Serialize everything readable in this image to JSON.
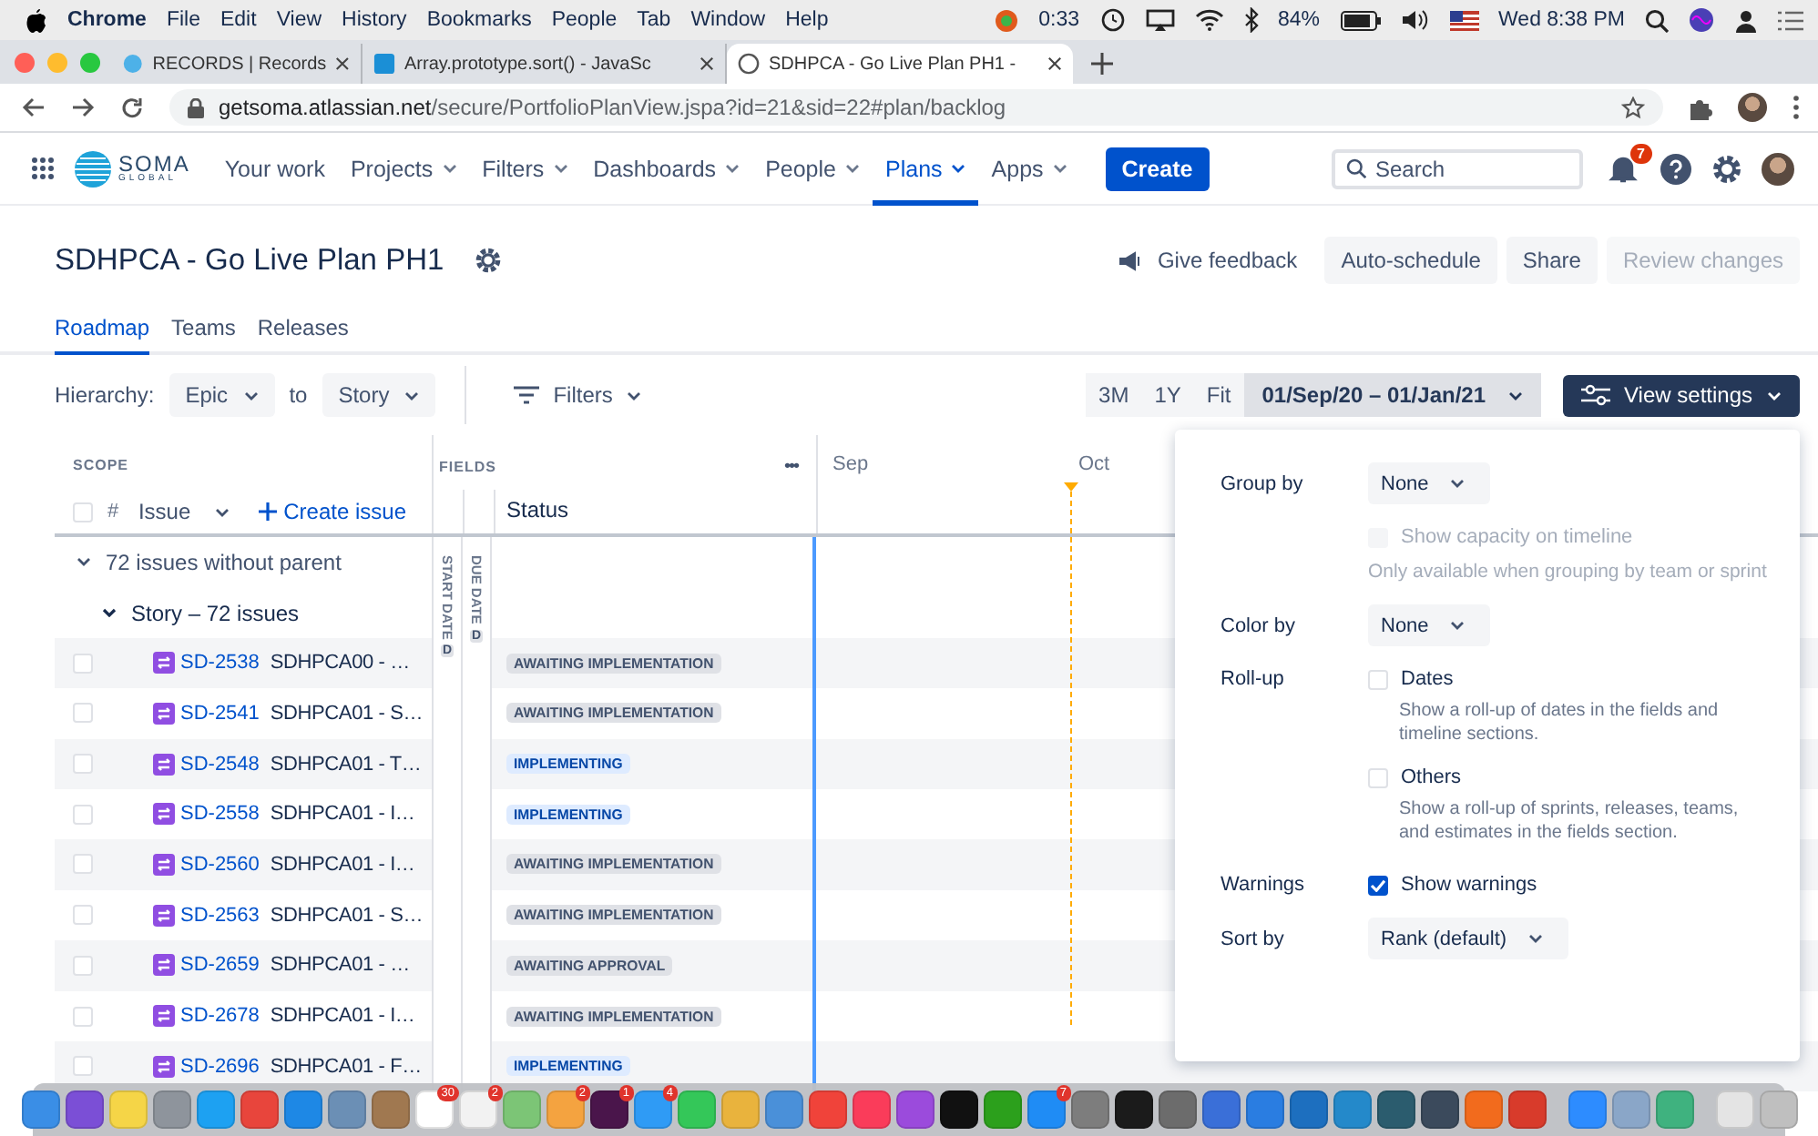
{
  "menubar": {
    "app": "Chrome",
    "menus": [
      "File",
      "Edit",
      "View",
      "History",
      "Bookmarks",
      "People",
      "Tab",
      "Window",
      "Help"
    ],
    "timer": "0:33",
    "battery": "84%",
    "clock": "Wed 8:38 PM"
  },
  "browser_tabs": [
    {
      "title": "RECORDS | Records",
      "selected": false
    },
    {
      "title": "Array.prototype.sort() - JavaSc",
      "selected": false
    },
    {
      "title": "SDHPCA - Go Live Plan PH1 -",
      "selected": true
    }
  ],
  "address": {
    "host": "getsoma.atlassian.net",
    "path": "/secure/PortfolioPlanView.jspa?id=21&sid=22#plan/backlog"
  },
  "nav": {
    "logo_top": "SOMA",
    "logo_bottom": "GLOBAL",
    "items": [
      {
        "label": "Your work",
        "dropdown": false,
        "selected": false
      },
      {
        "label": "Projects",
        "dropdown": true,
        "selected": false
      },
      {
        "label": "Filters",
        "dropdown": true,
        "selected": false
      },
      {
        "label": "Dashboards",
        "dropdown": true,
        "selected": false
      },
      {
        "label": "People",
        "dropdown": true,
        "selected": false
      },
      {
        "label": "Plans",
        "dropdown": true,
        "selected": true
      },
      {
        "label": "Apps",
        "dropdown": true,
        "selected": false
      }
    ],
    "create": "Create",
    "search_placeholder": "Search",
    "notifications": "7"
  },
  "header": {
    "title": "SDHPCA - Go Live Plan PH1",
    "actions": [
      {
        "label": "Give feedback",
        "kind": "link"
      },
      {
        "label": "Auto-schedule",
        "kind": "button",
        "disabled": false
      },
      {
        "label": "Share",
        "kind": "button",
        "disabled": false
      },
      {
        "label": "Review changes",
        "kind": "button",
        "disabled": true
      }
    ]
  },
  "page_tabs": [
    {
      "label": "Roadmap",
      "selected": true
    },
    {
      "label": "Teams",
      "selected": false
    },
    {
      "label": "Releases",
      "selected": false
    }
  ],
  "toolbar": {
    "hierarchy_label": "Hierarchy:",
    "from": "Epic",
    "to_label": "to",
    "to": "Story",
    "filters": "Filters",
    "ranges": [
      "3M",
      "1Y",
      "Fit"
    ],
    "date_range": "01/Sep/20 – 01/Jan/21",
    "view_settings": "View settings"
  },
  "table": {
    "scope": "SCOPE",
    "select_all_checked": false,
    "hash": "#",
    "issue": "Issue",
    "create_issue": "Create issue",
    "fields": "FIELDS",
    "more": "•••",
    "start_date": "START DATE",
    "start_badge": "D",
    "due_date": "DUE DATE",
    "due_badge": "D",
    "status": "Status",
    "months": [
      "Sep",
      "Oct"
    ],
    "group": {
      "label": "72 issues without parent",
      "expanded": true
    },
    "subgroup": {
      "label": "Story – 72 issues",
      "expanded": true
    },
    "rows": [
      {
        "key": "SD-2538",
        "summary": "SDHPCA00 - …",
        "status": "AWAITING IMPLEMENTATION",
        "kind": "awaiting",
        "checked": false
      },
      {
        "key": "SD-2541",
        "summary": "SDHPCA01 - S…",
        "status": "AWAITING IMPLEMENTATION",
        "kind": "awaiting",
        "checked": false
      },
      {
        "key": "SD-2548",
        "summary": "SDHPCA01 - T…",
        "status": "IMPLEMENTING",
        "kind": "implementing",
        "checked": false
      },
      {
        "key": "SD-2558",
        "summary": "SDHPCA01 - I…",
        "status": "IMPLEMENTING",
        "kind": "implementing",
        "checked": false
      },
      {
        "key": "SD-2560",
        "summary": "SDHPCA01 - I…",
        "status": "AWAITING IMPLEMENTATION",
        "kind": "awaiting",
        "checked": false
      },
      {
        "key": "SD-2563",
        "summary": "SDHPCA01 - S…",
        "status": "AWAITING IMPLEMENTATION",
        "kind": "awaiting",
        "checked": false
      },
      {
        "key": "SD-2659",
        "summary": "SDHPCA01 - …",
        "status": "AWAITING APPROVAL",
        "kind": "awaiting",
        "checked": false
      },
      {
        "key": "SD-2678",
        "summary": "SDHPCA01 - I…",
        "status": "AWAITING IMPLEMENTATION",
        "kind": "awaiting",
        "checked": false
      },
      {
        "key": "SD-2696",
        "summary": "SDHPCA01 - F…",
        "status": "IMPLEMENTING",
        "kind": "implementing",
        "checked": false
      }
    ]
  },
  "panel": {
    "group_by": {
      "label": "Group by",
      "value": "None"
    },
    "capacity": {
      "label": "Show capacity on timeline",
      "checked": false,
      "disabled": true,
      "hint": "Only available when grouping by team or sprint"
    },
    "color_by": {
      "label": "Color by",
      "value": "None"
    },
    "rollup": {
      "label": "Roll-up",
      "options": [
        {
          "label": "Dates",
          "checked": false,
          "description": "Show a roll-up of dates in the fields and timeline sections."
        },
        {
          "label": "Others",
          "checked": false,
          "description": "Show a roll-up of sprints, releases, teams, and estimates in the fields section."
        }
      ]
    },
    "warnings": {
      "label": "Warnings",
      "option": "Show warnings",
      "checked": true
    },
    "sort_by": {
      "label": "Sort by",
      "value": "Rank (default)"
    }
  },
  "dock": [
    {
      "color": "#3a8ee6"
    },
    {
      "color": "#7b4fd6"
    },
    {
      "color": "#f5d547"
    },
    {
      "color": "#8e949c"
    },
    {
      "color": "#1da1f2"
    },
    {
      "color": "#e8453c"
    },
    {
      "color": "#1e88e5"
    },
    {
      "color": "#6b8fb5"
    },
    {
      "color": "#a07850"
    },
    {
      "color": "#ffffff",
      "badge": "30"
    },
    {
      "color": "#f2f2f2",
      "badge": "2"
    },
    {
      "color": "#7cc576"
    },
    {
      "color": "#f4a340",
      "badge": "2"
    },
    {
      "color": "#4a154b",
      "badge": "1"
    },
    {
      "color": "#2f9bf5",
      "badge": "4"
    },
    {
      "color": "#34c759"
    },
    {
      "color": "#e9b33d"
    },
    {
      "color": "#4a90d9"
    },
    {
      "color": "#f0433a"
    },
    {
      "color": "#fa3c5a"
    },
    {
      "color": "#9b4bdc"
    },
    {
      "color": "#111111"
    },
    {
      "color": "#2ca01c"
    },
    {
      "color": "#1f8cf5",
      "badge": "7"
    },
    {
      "color": "#7d7d7d"
    },
    {
      "color": "#1b1b1b"
    },
    {
      "color": "#6c6c6c"
    },
    {
      "color": "#3a6fd8"
    },
    {
      "color": "#2a7de1"
    },
    {
      "color": "#1d6fbf"
    },
    {
      "color": "#2489ca"
    },
    {
      "color": "#2b5c6e"
    },
    {
      "color": "#3b4a5c"
    },
    {
      "color": "#f26b1d"
    },
    {
      "color": "#d83b2b"
    },
    {
      "color": "#2d8cff"
    },
    {
      "color": "#8aa6c8"
    },
    {
      "color": "#3fb27f"
    },
    {
      "color": "#e4e4e4"
    },
    {
      "color": "#bfbfbf"
    }
  ]
}
